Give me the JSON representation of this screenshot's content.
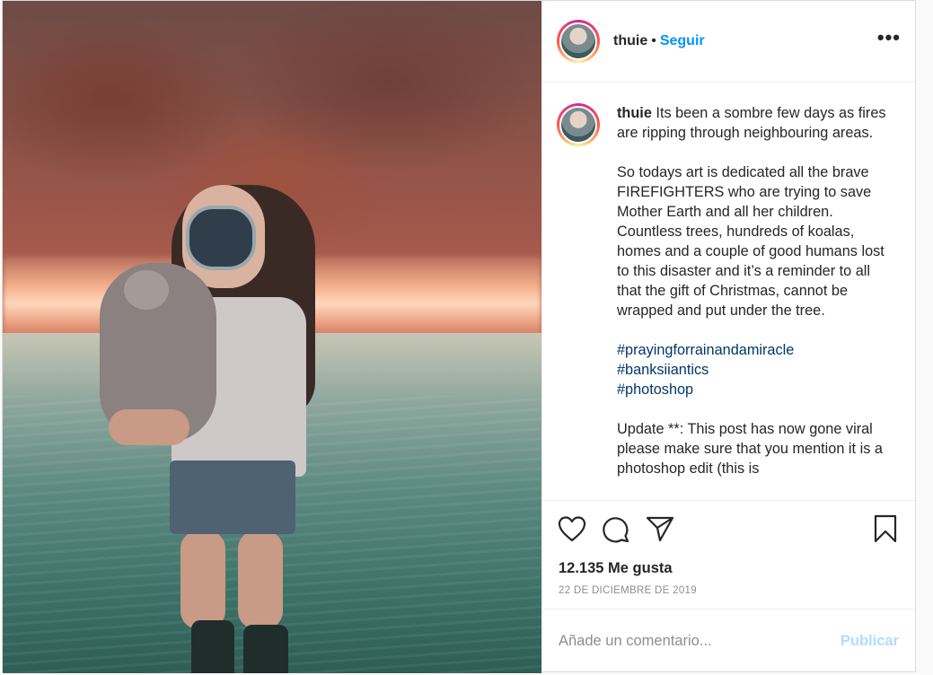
{
  "post": {
    "username": "thuie",
    "follow_label": "Seguir",
    "dot": "•",
    "more": "•••"
  },
  "caption": {
    "username": "thuie",
    "p1": " Its been a sombre few days as fires are ripping through neighbouring areas.",
    "p2": "So todays art is dedicated all the brave FIREFIGHTERS who are trying to save Mother Earth and all her children. Countless trees, hundreds of koalas, homes and a couple of good humans lost to this disaster and it’s a reminder to all that the gift of Christmas, cannot be wrapped and put under the tree.",
    "hashtags": [
      "#prayingforrainandamiracle",
      "#banksiiantics",
      "#photoshop"
    ],
    "p3": "Update **: This post has now gone viral please make sure that you mention it is a photoshop edit (this is"
  },
  "likes_text": "12.135 Me gusta",
  "date_text": "22 DE DICIEMBRE DE 2019",
  "comment_input": {
    "placeholder": "Añade un comentario..."
  },
  "publish_label": "Publicar",
  "icons": [
    "heart-icon",
    "comment-icon",
    "share-icon",
    "bookmark-icon",
    "more-options-icon"
  ]
}
